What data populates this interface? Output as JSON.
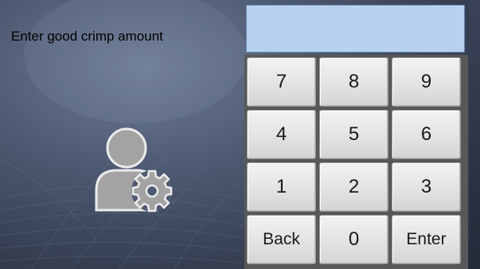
{
  "prompt": {
    "label": "Enter good crimp amount"
  },
  "display": {
    "value": ""
  },
  "keypad": {
    "keys": [
      "7",
      "8",
      "9",
      "4",
      "5",
      "6",
      "1",
      "2",
      "3",
      "Back",
      "0",
      "Enter"
    ]
  },
  "icons": {
    "user": "user-settings-icon"
  },
  "colors": {
    "display_bg": "#b7d2f0",
    "key_face": "#e3e3e3",
    "background": "#4f5b73"
  }
}
